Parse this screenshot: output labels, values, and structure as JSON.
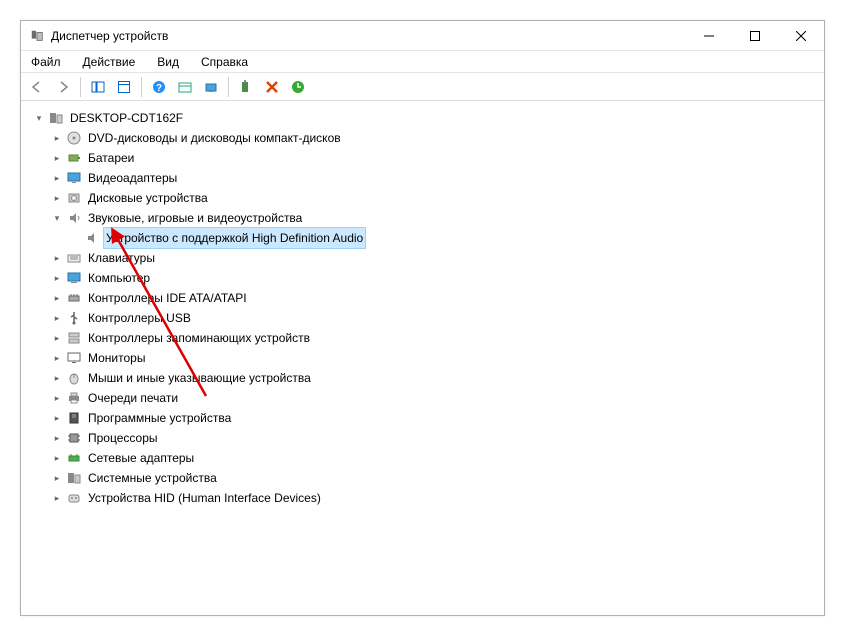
{
  "window": {
    "title": "Диспетчер устройств"
  },
  "menu": {
    "file": "Файл",
    "action": "Действие",
    "view": "Вид",
    "help": "Справка"
  },
  "tree": {
    "root": "DESKTOP-CDT162F",
    "nodes": [
      "DVD-дисководы и дисководы компакт-дисков",
      "Батареи",
      "Видеоадаптеры",
      "Дисковые устройства",
      "Звуковые, игровые и видеоустройства",
      "Клавиатуры",
      "Компьютер",
      "Контроллеры IDE ATA/ATAPI",
      "Контроллеры USB",
      "Контроллеры запоминающих устройств",
      "Мониторы",
      "Мыши и иные указывающие устройства",
      "Очереди печати",
      "Программные устройства",
      "Процессоры",
      "Сетевые адаптеры",
      "Системные устройства",
      "Устройства HID (Human Interface Devices)"
    ],
    "audio_child": "Устройство с поддержкой High Definition Audio"
  }
}
